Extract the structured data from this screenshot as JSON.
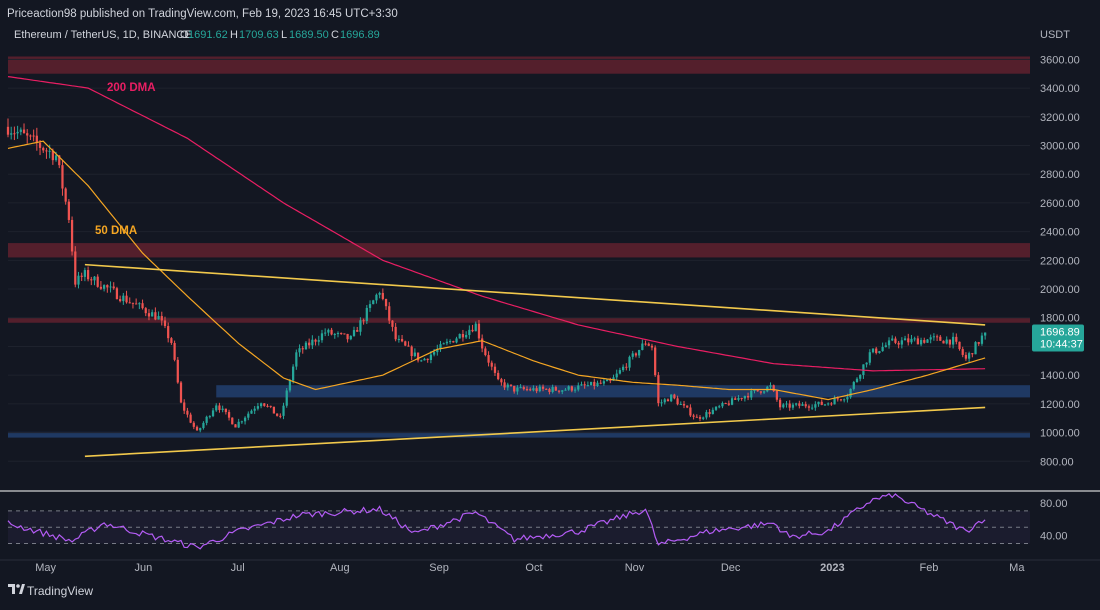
{
  "publisher_line": "Priceaction98 published on TradingView.com, Feb 19, 2023 16:45 UTC+3:30",
  "symbol_line": {
    "name": "Ethereum / TetherUS, 1D, BINANCE",
    "o_label": "O",
    "o_value": "1691.62",
    "h_label": "H",
    "h_value": "1709.63",
    "l_label": "L",
    "l_value": "1689.50",
    "c_label": "C",
    "c_value": "1696.89"
  },
  "currency": "USDT",
  "last_price_tag": {
    "price": "1696.89",
    "countdown": "10:44:37"
  },
  "labels": {
    "dma200": "200 DMA",
    "dma50": "50 DMA"
  },
  "footer_brand": "TradingView",
  "colors": {
    "background": "#131722",
    "up": "#26a69a",
    "down": "#ef5350",
    "dma200": "#e91e63",
    "dma50": "#f5a623",
    "trendline": "#f2c94c",
    "rsi": "#b45cf5",
    "resistance_zone": "#6b2330",
    "support_zone": "#22406e"
  },
  "chart_data": {
    "type": "candlestick",
    "x_axis": {
      "start": "2022-04-20",
      "end": "2023-03-05",
      "labels": [
        {
          "date": "2022-05-01",
          "text": "May"
        },
        {
          "date": "2022-06-01",
          "text": "Jun"
        },
        {
          "date": "2022-07-01",
          "text": "Jul"
        },
        {
          "date": "2022-08-01",
          "text": "Aug"
        },
        {
          "date": "2022-09-01",
          "text": "Sep"
        },
        {
          "date": "2022-10-01",
          "text": "Oct"
        },
        {
          "date": "2022-11-01",
          "text": "Nov"
        },
        {
          "date": "2022-12-01",
          "text": "Dec"
        },
        {
          "date": "2023-01-01",
          "text": "2023"
        },
        {
          "date": "2023-02-01",
          "text": "Feb"
        },
        {
          "date": "2023-03-01",
          "text": "Ma"
        }
      ]
    },
    "price_axis": {
      "ylim": [
        600,
        3700
      ],
      "ticks": [
        3600,
        3400,
        3200,
        3000,
        2800,
        2600,
        2400,
        2200,
        2000,
        1800,
        1600,
        1400,
        1200,
        1000,
        800
      ],
      "tick_labels": [
        "3600.00",
        "3400.00",
        "3200.00",
        "3000.00",
        "2800.00",
        "2600.00",
        "2400.00",
        "2200.00",
        "2000.00",
        "1800.00",
        "1600.00",
        "1400.00",
        "1200.00",
        "1000.00",
        "800.00"
      ]
    },
    "zones": [
      {
        "low": 3500,
        "high": 3620,
        "kind": "resistance"
      },
      {
        "low": 2220,
        "high": 2320,
        "kind": "resistance"
      },
      {
        "low": 1765,
        "high": 1800,
        "kind": "resistance"
      },
      {
        "low": 1245,
        "high": 1330,
        "kind": "support"
      },
      {
        "low": 965,
        "high": 1005,
        "kind": "support"
      }
    ],
    "trendlines": [
      {
        "name": "descending",
        "points": [
          [
            "2022-05-14",
            2170
          ],
          [
            "2023-02-19",
            1750
          ]
        ]
      },
      {
        "name": "ascending",
        "points": [
          [
            "2022-05-14",
            835
          ],
          [
            "2023-02-19",
            1175
          ]
        ]
      }
    ],
    "anchors": [
      [
        "2022-04-20",
        3130
      ],
      [
        "2022-05-05",
        2930
      ],
      [
        "2022-05-09",
        2500
      ],
      [
        "2022-05-11",
        2050
      ],
      [
        "2022-05-14",
        2100
      ],
      [
        "2022-05-25",
        1950
      ],
      [
        "2022-06-06",
        1800
      ],
      [
        "2022-06-10",
        1630
      ],
      [
        "2022-06-13",
        1200
      ],
      [
        "2022-06-18",
        1000
      ],
      [
        "2022-06-24",
        1200
      ],
      [
        "2022-06-30",
        1050
      ],
      [
        "2022-07-08",
        1220
      ],
      [
        "2022-07-14",
        1100
      ],
      [
        "2022-07-19",
        1550
      ],
      [
        "2022-07-28",
        1700
      ],
      [
        "2022-08-05",
        1650
      ],
      [
        "2022-08-14",
        1990
      ],
      [
        "2022-08-19",
        1650
      ],
      [
        "2022-08-27",
        1500
      ],
      [
        "2022-09-06",
        1650
      ],
      [
        "2022-09-13",
        1750
      ],
      [
        "2022-09-15",
        1600
      ],
      [
        "2022-09-20",
        1350
      ],
      [
        "2022-09-25",
        1300
      ],
      [
        "2022-10-10",
        1300
      ],
      [
        "2022-10-25",
        1350
      ],
      [
        "2022-11-05",
        1630
      ],
      [
        "2022-11-07",
        1600
      ],
      [
        "2022-11-09",
        1200
      ],
      [
        "2022-11-13",
        1250
      ],
      [
        "2022-11-21",
        1100
      ],
      [
        "2022-12-05",
        1250
      ],
      [
        "2022-12-14",
        1320
      ],
      [
        "2022-12-17",
        1180
      ],
      [
        "2022-12-31",
        1200
      ],
      [
        "2023-01-07",
        1260
      ],
      [
        "2023-01-14",
        1550
      ],
      [
        "2023-01-21",
        1630
      ],
      [
        "2023-02-03",
        1650
      ],
      [
        "2023-02-09",
        1640
      ],
      [
        "2023-02-13",
        1510
      ],
      [
        "2023-02-19",
        1696.89
      ]
    ],
    "dma50_anchors": [
      [
        "2022-04-20",
        2980
      ],
      [
        "2022-05-01",
        3030
      ],
      [
        "2022-05-15",
        2720
      ],
      [
        "2022-06-01",
        2250
      ],
      [
        "2022-06-15",
        1950
      ],
      [
        "2022-07-01",
        1620
      ],
      [
        "2022-07-15",
        1380
      ],
      [
        "2022-07-25",
        1300
      ],
      [
        "2022-08-15",
        1400
      ],
      [
        "2022-09-01",
        1580
      ],
      [
        "2022-09-15",
        1640
      ],
      [
        "2022-10-01",
        1500
      ],
      [
        "2022-10-15",
        1400
      ],
      [
        "2022-11-01",
        1350
      ],
      [
        "2022-11-15",
        1330
      ],
      [
        "2022-12-01",
        1300
      ],
      [
        "2022-12-15",
        1300
      ],
      [
        "2023-01-01",
        1230
      ],
      [
        "2023-01-15",
        1300
      ],
      [
        "2023-02-01",
        1400
      ],
      [
        "2023-02-19",
        1520
      ]
    ],
    "dma200_anchors": [
      [
        "2022-04-20",
        3480
      ],
      [
        "2022-05-15",
        3400
      ],
      [
        "2022-06-15",
        3050
      ],
      [
        "2022-07-15",
        2600
      ],
      [
        "2022-08-15",
        2200
      ],
      [
        "2022-09-15",
        1950
      ],
      [
        "2022-10-15",
        1750
      ],
      [
        "2022-11-15",
        1600
      ],
      [
        "2022-12-15",
        1480
      ],
      [
        "2023-01-15",
        1430
      ],
      [
        "2023-02-19",
        1445
      ]
    ],
    "rsi": {
      "ylim": [
        22,
        92
      ],
      "levels": [
        70,
        50,
        30
      ],
      "tick_labels": [
        "80.00",
        "40.00"
      ],
      "tick_values": [
        80,
        40
      ],
      "anchors": [
        [
          "2022-04-20",
          55
        ],
        [
          "2022-05-10",
          33
        ],
        [
          "2022-05-20",
          55
        ],
        [
          "2022-06-01",
          42
        ],
        [
          "2022-06-18",
          25
        ],
        [
          "2022-07-01",
          45
        ],
        [
          "2022-07-20",
          65
        ],
        [
          "2022-08-14",
          72
        ],
        [
          "2022-08-25",
          42
        ],
        [
          "2022-09-13",
          68
        ],
        [
          "2022-09-25",
          35
        ],
        [
          "2022-10-15",
          45
        ],
        [
          "2022-11-05",
          72
        ],
        [
          "2022-11-09",
          28
        ],
        [
          "2022-11-25",
          45
        ],
        [
          "2022-12-15",
          55
        ],
        [
          "2022-12-20",
          38
        ],
        [
          "2023-01-01",
          45
        ],
        [
          "2023-01-14",
          82
        ],
        [
          "2023-01-21",
          90
        ],
        [
          "2023-02-01",
          68
        ],
        [
          "2023-02-13",
          45
        ],
        [
          "2023-02-19",
          62
        ]
      ]
    }
  }
}
